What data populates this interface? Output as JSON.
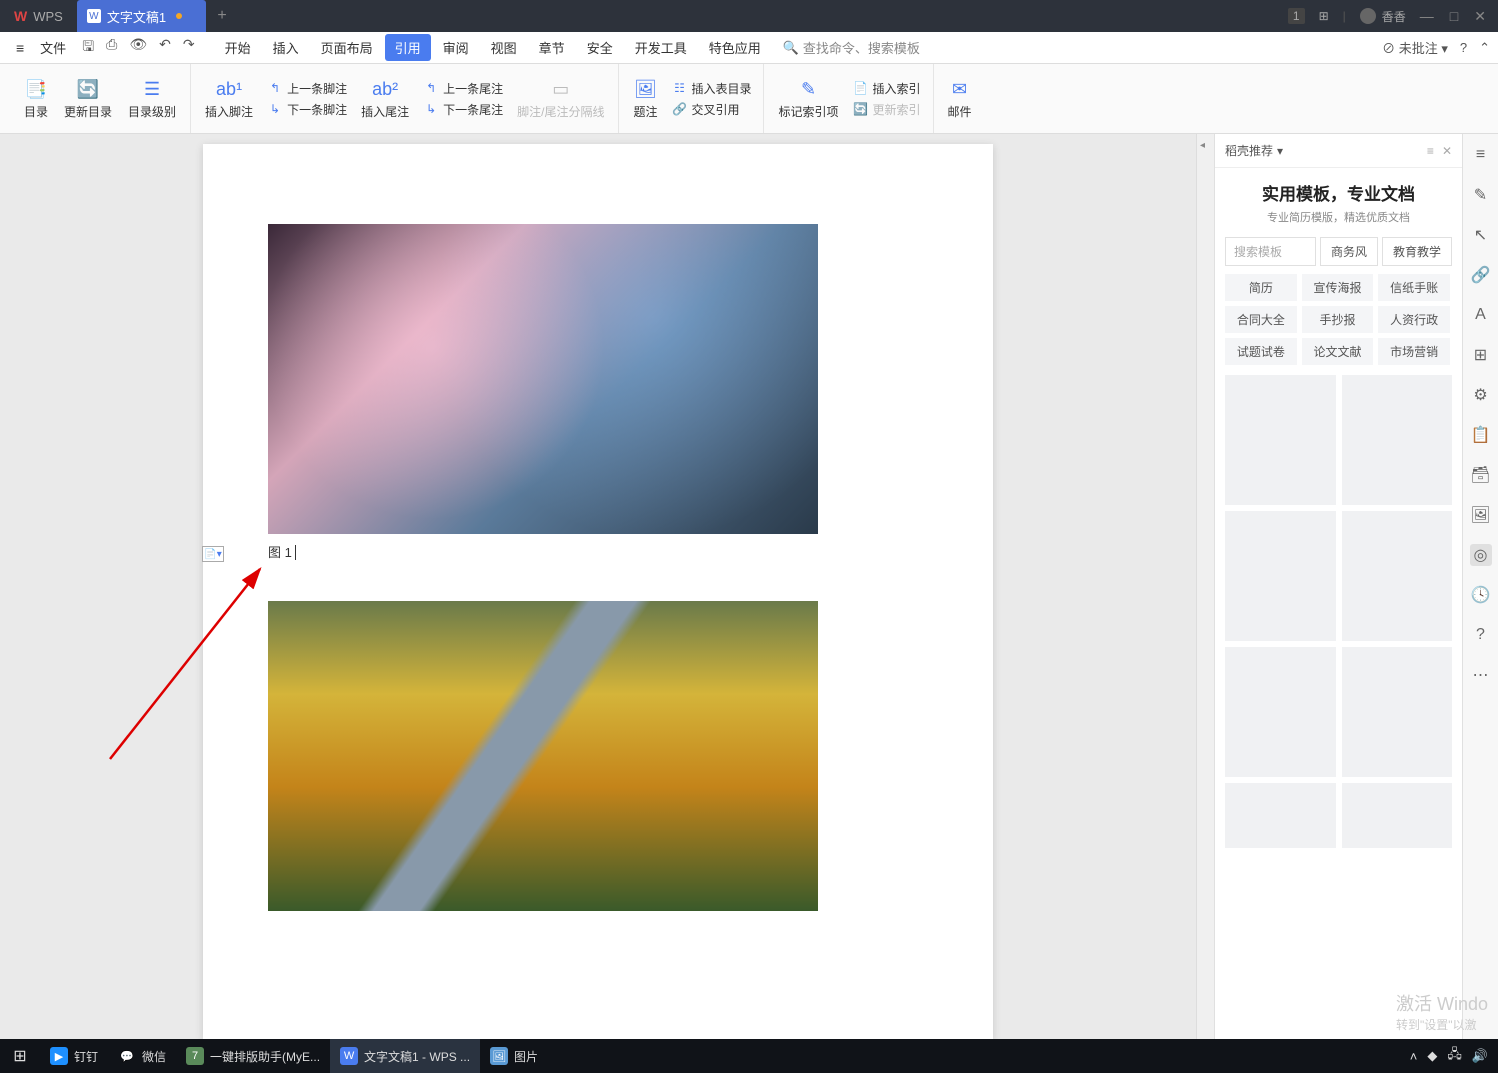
{
  "titlebar": {
    "app_label": "WPS",
    "doc_tab_label": "文字文稿1",
    "badge": "1",
    "user_name": "香香"
  },
  "menubar": {
    "file_label": "文件",
    "tabs": [
      "开始",
      "插入",
      "页面布局",
      "引用",
      "审阅",
      "视图",
      "章节",
      "安全",
      "开发工具",
      "特色应用"
    ],
    "active_index": 3,
    "search_placeholder": "查找命令、搜索模板",
    "annotate_label": "未批注"
  },
  "ribbon": {
    "toc": {
      "dir": "目录",
      "update": "更新目录",
      "level": "目录级别"
    },
    "footnote": {
      "insert": "插入脚注",
      "prev": "上一条脚注",
      "next": "下一条脚注"
    },
    "endnote": {
      "insert": "插入尾注",
      "prev": "上一条尾注",
      "next": "下一条尾注",
      "sep": "脚注/尾注分隔线"
    },
    "caption": {
      "caption": "题注",
      "insert_table": "插入表目录",
      "cross": "交叉引用"
    },
    "index": {
      "mark": "标记索引项",
      "insert": "插入索引",
      "update": "更新索引"
    },
    "mail": {
      "mail": "邮件"
    }
  },
  "document": {
    "caption_text": "图 1"
  },
  "panel": {
    "header": "稻壳推荐",
    "title": "实用模板，专业文档",
    "subtitle": "专业简历模版，精选优质文档",
    "search_placeholder": "搜索模板",
    "chips": [
      "商务风",
      "教育教学"
    ],
    "tags": [
      "简历",
      "宣传海报",
      "信纸手账",
      "合同大全",
      "手抄报",
      "人资行政",
      "试题试卷",
      "论文文献",
      "市场营销"
    ]
  },
  "watermark": {
    "line1": "激活 Windo",
    "line2": "转到\"设置\"以激"
  },
  "taskbar": {
    "items": [
      {
        "label": "钉钉",
        "color": "#1e90ff"
      },
      {
        "label": "微信",
        "color": "#3cb371"
      },
      {
        "label": "一键排版助手(MyE...",
        "color": "#5a8a5a"
      },
      {
        "label": "文字文稿1 - WPS ...",
        "color": "#4a7cef"
      },
      {
        "label": "图片",
        "color": "#5a9ad4"
      }
    ]
  }
}
